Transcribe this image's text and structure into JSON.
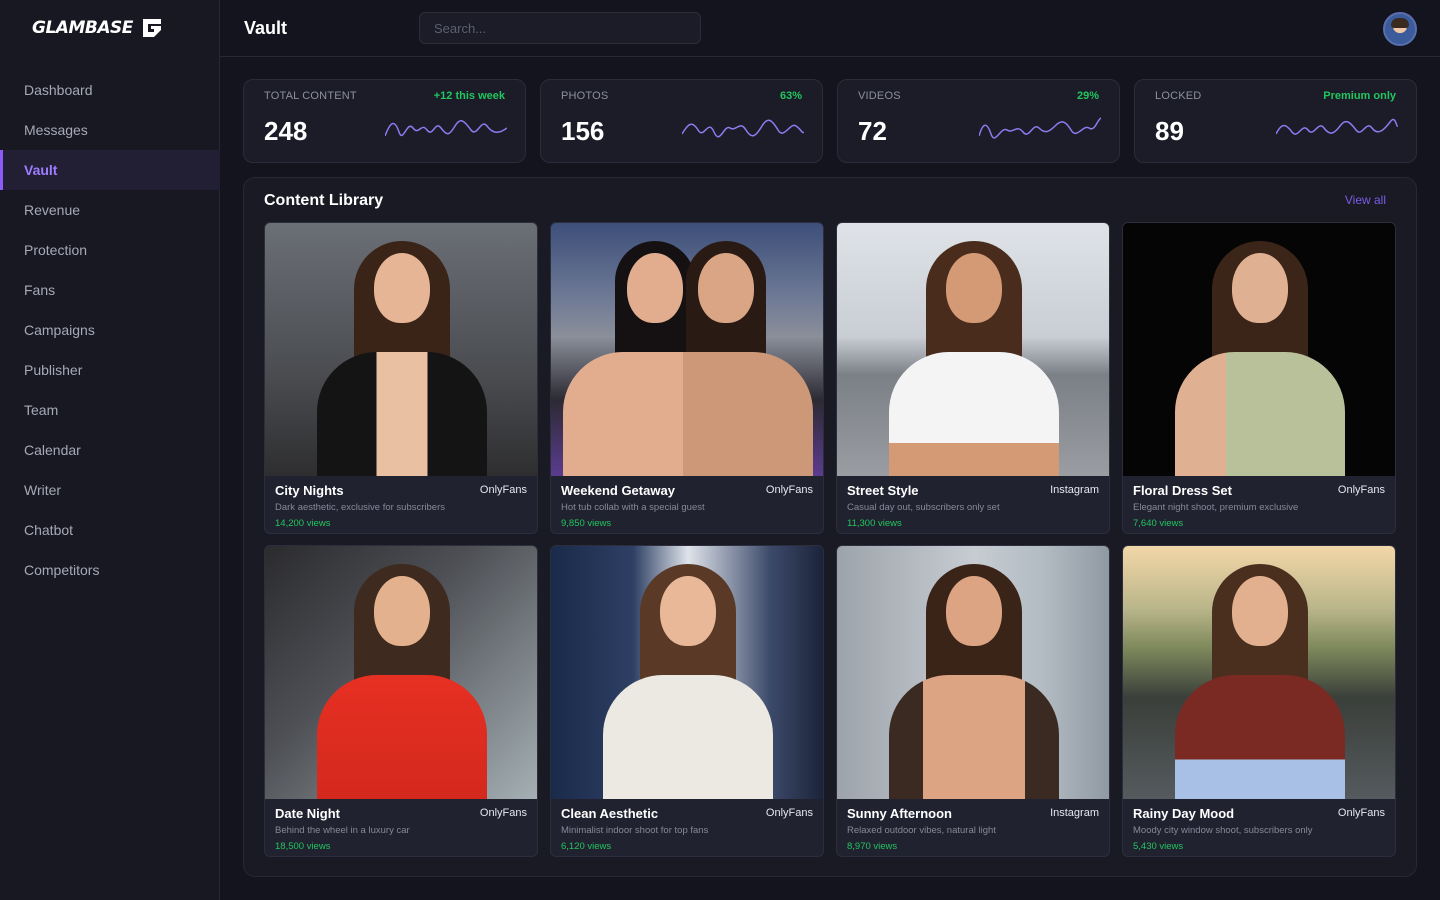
{
  "brand": {
    "name": "GLAMBASE"
  },
  "sidebar": {
    "items": [
      {
        "label": "Dashboard"
      },
      {
        "label": "Messages"
      },
      {
        "label": "Vault"
      },
      {
        "label": "Revenue"
      },
      {
        "label": "Protection"
      },
      {
        "label": "Fans"
      },
      {
        "label": "Campaigns"
      },
      {
        "label": "Publisher"
      },
      {
        "label": "Team"
      },
      {
        "label": "Calendar"
      },
      {
        "label": "Writer"
      },
      {
        "label": "Chatbot"
      },
      {
        "label": "Competitors"
      }
    ],
    "active": "Vault"
  },
  "header": {
    "title": "Vault",
    "search_placeholder": "Search..."
  },
  "stats": [
    {
      "label": "TOTAL CONTENT",
      "delta": "+12 this week",
      "value": "248"
    },
    {
      "label": "PHOTOS",
      "delta": "63%",
      "value": "156"
    },
    {
      "label": "VIDEOS",
      "delta": "29%",
      "value": "72"
    },
    {
      "label": "LOCKED",
      "delta": "Premium only",
      "value": "89"
    }
  ],
  "library": {
    "title": "Content Library",
    "view_all": "View all",
    "items": [
      {
        "name": "City Nights",
        "platform": "OnlyFans",
        "desc": "Dark aesthetic, exclusive for subscribers",
        "views": "14,200 views"
      },
      {
        "name": "Weekend Getaway",
        "platform": "OnlyFans",
        "desc": "Hot tub collab with a special guest",
        "views": "9,850 views"
      },
      {
        "name": "Street Style",
        "platform": "Instagram",
        "desc": "Casual day out, subscribers only set",
        "views": "11,300 views"
      },
      {
        "name": "Floral Dress Set",
        "platform": "OnlyFans",
        "desc": "Elegant night shoot, premium exclusive",
        "views": "7,640 views"
      },
      {
        "name": "Date Night",
        "platform": "OnlyFans",
        "desc": "Behind the wheel in a luxury car",
        "views": "18,500 views"
      },
      {
        "name": "Clean Aesthetic",
        "platform": "OnlyFans",
        "desc": "Minimalist indoor shoot for top fans",
        "views": "6,120 views"
      },
      {
        "name": "Sunny Afternoon",
        "platform": "Instagram",
        "desc": "Relaxed outdoor vibes, natural light",
        "views": "8,970 views"
      },
      {
        "name": "Rainy Day Mood",
        "platform": "OnlyFans",
        "desc": "Moody city window shoot, subscribers only",
        "views": "5,430 views"
      }
    ]
  },
  "colors": {
    "accent": "#8b5cf6",
    "positive": "#22c55e",
    "sparkline": "#8b7cf0"
  }
}
